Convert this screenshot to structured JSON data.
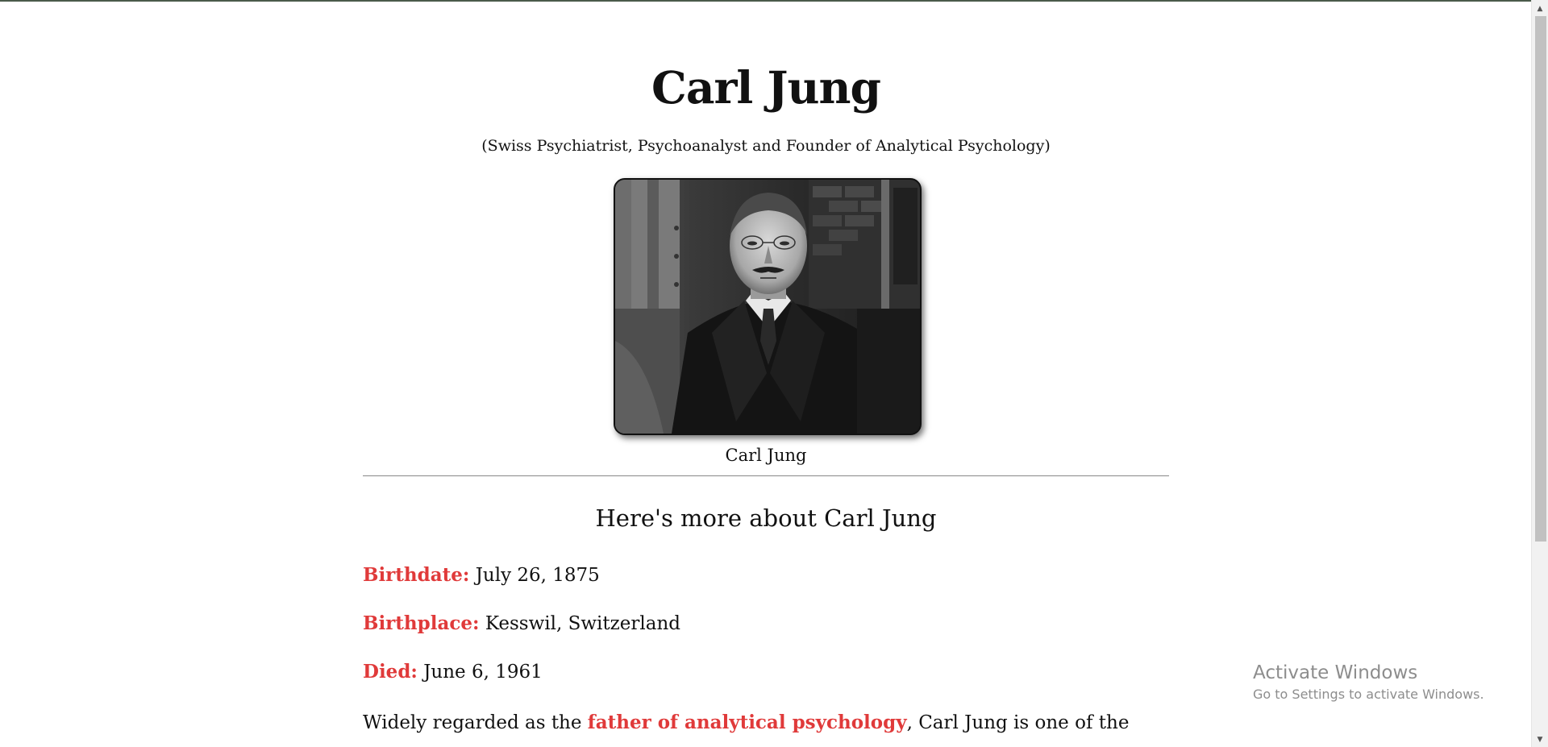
{
  "title": "Carl Jung",
  "subtitle": "(Swiss Psychiatrist, Psychoanalyst and Founder of Analytical Psychology)",
  "portrait": {
    "caption": "Carl Jung"
  },
  "section_heading": "Here's more about Carl Jung",
  "facts": [
    {
      "key": "Birthdate:",
      "value": "July 26, 1875"
    },
    {
      "key": "Birthplace:",
      "value": "Kesswil, Switzerland"
    },
    {
      "key": "Died:",
      "value": "June 6, 1961"
    }
  ],
  "paragraph": {
    "before": "Widely regarded as the ",
    "link": "father of analytical psychology",
    "after": ", Carl Jung is one of the"
  },
  "watermark": {
    "title": "Activate Windows",
    "subtitle": "Go to Settings to activate Windows."
  },
  "colors": {
    "accent": "#e03a3a"
  }
}
